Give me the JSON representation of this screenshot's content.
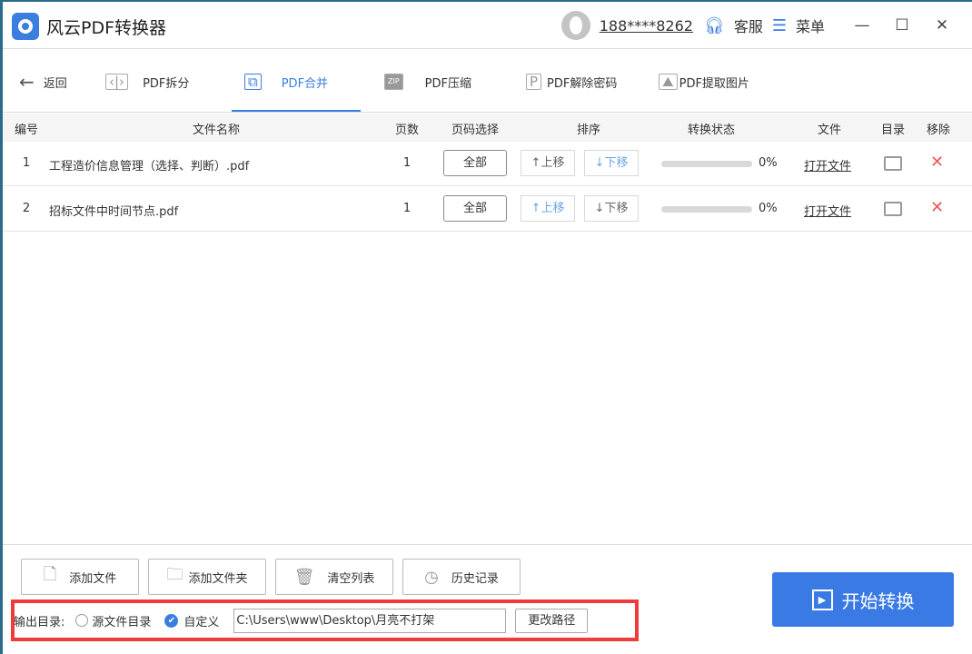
{
  "app": {
    "title": "风云PDF转换器",
    "user": "188****8262",
    "service": "客服",
    "menu": "菜单"
  },
  "tabs": {
    "back": "返回",
    "items": [
      {
        "label": "PDF拆分"
      },
      {
        "label": "PDF合并"
      },
      {
        "label": "PDF压缩"
      },
      {
        "label": "PDF解除密码"
      },
      {
        "label": "PDF提取图片"
      }
    ],
    "active": "PDF合并"
  },
  "table": {
    "headers": [
      "编号",
      "文件名称",
      "页数",
      "页码选择",
      "排序",
      "转换状态",
      "文件",
      "目录",
      "移除"
    ],
    "rows": [
      {
        "index": "1",
        "name": "工程造价信息管理（选择、判断）.pdf",
        "pages": "1",
        "page_select": "全部",
        "up": "↑上移",
        "down": "↓下移",
        "progress": 0,
        "progress_text": "0%",
        "open": "打开文件"
      },
      {
        "index": "2",
        "name": "招标文件中时间节点.pdf",
        "pages": "1",
        "page_select": "全部",
        "up": "↑上移",
        "down": "↓下移",
        "progress": 0,
        "progress_text": "0%",
        "open": "打开文件"
      }
    ]
  },
  "bottom": {
    "add_file": "添加文件",
    "add_folder": "添加文件夹",
    "clear": "清空列表",
    "history": "历史记录",
    "output_label": "输出目录:",
    "opt_source": "源文件目录",
    "opt_custom": "自定义",
    "path": "C:\\Users\\www\\Desktop\\月亮不打架",
    "change_path": "更改路径",
    "start": "开始转换"
  },
  "colors": {
    "accent": "#3a7ee0",
    "highlight": "#ef3b3b"
  }
}
